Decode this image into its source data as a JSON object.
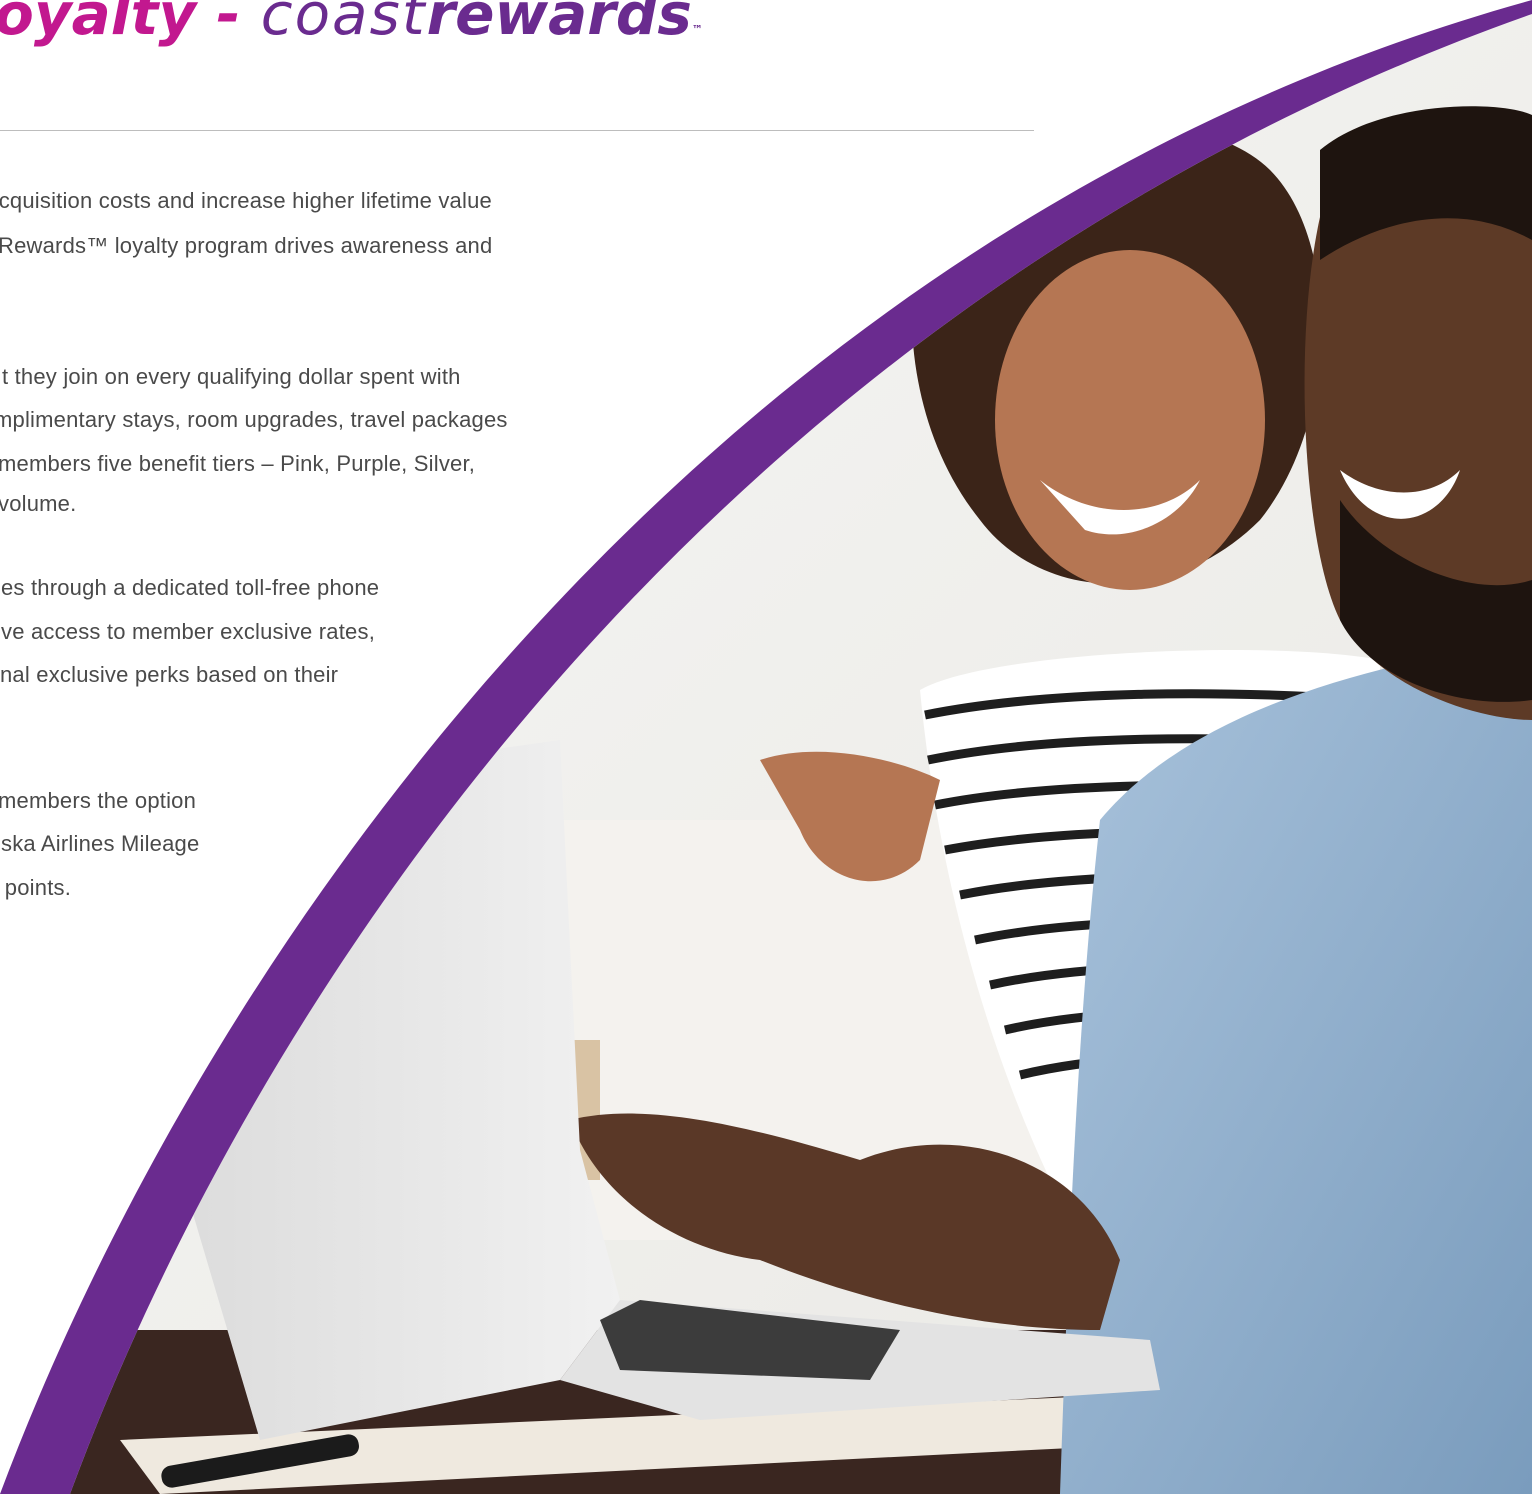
{
  "heading": {
    "loyalty": "oyalty -",
    "coast": "coast",
    "rewards": "rewards",
    "tm": "™"
  },
  "body_lines": [
    "er acquisition costs and increase higher lifetime value",
    "Rewards™ loyalty program drives awareness and",
    "t they join on every qualifying dollar spent with",
    "mplimentary stays, room upgrades, travel packages",
    "members five benefit tiers – Pink, Purple, Silver,",
    "volume.",
    "es through a dedicated toll-free phone",
    "ve access to member exclusive rates,",
    "nal exclusive perks based on their",
    "members the option",
    "ska Airlines Mileage",
    "ls™ points."
  ],
  "colors": {
    "magenta": "#c2188f",
    "purple": "#6a2b8f",
    "text": "#4a4a4a",
    "rule": "#bdbdbd"
  }
}
